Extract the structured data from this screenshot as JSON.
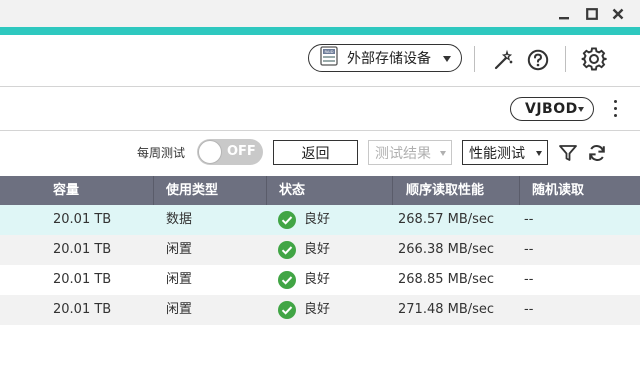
{
  "window": {
    "minimize_icon": "minimize-icon",
    "maximize_icon": "maximize-icon",
    "close_icon": "close-icon"
  },
  "colors": {
    "accent": "#2ec8bf",
    "header_bg": "#6d7080",
    "row_selected": "#dff6f6",
    "row_alt": "#f2f2f2",
    "status_ok": "#41a545",
    "toggle_off": "#c9c9c9"
  },
  "toolbar": {
    "external_storage_label": "外部存储设备",
    "external_storage_icon": "raid-drive-icon",
    "tool_icon": "wand-icon",
    "help_icon": "help-icon",
    "settings_icon": "gear-icon"
  },
  "device": {
    "selected": "VJBOD",
    "more_icon": "more-vertical-icon"
  },
  "controls": {
    "weekly_test_label": "每周测试",
    "toggle_state": "OFF",
    "back_label": "返回",
    "test_results_label": "测试结果",
    "performance_test_label": "性能测试",
    "filter_icon": "filter-icon",
    "refresh_icon": "refresh-icon"
  },
  "table": {
    "headers": [
      "容量",
      "使用类型",
      "状态",
      "顺序读取性能",
      "随机读取"
    ],
    "rows": [
      {
        "capacity": "20.01 TB",
        "usage": "数据",
        "status": "良好",
        "seq_read": "268.57 MB/sec",
        "random_read": "--",
        "selected": true
      },
      {
        "capacity": "20.01 TB",
        "usage": "闲置",
        "status": "良好",
        "seq_read": "266.38 MB/sec",
        "random_read": "--",
        "selected": false
      },
      {
        "capacity": "20.01 TB",
        "usage": "闲置",
        "status": "良好",
        "seq_read": "268.85 MB/sec",
        "random_read": "--",
        "selected": false
      },
      {
        "capacity": "20.01 TB",
        "usage": "闲置",
        "status": "良好",
        "seq_read": "271.48 MB/sec",
        "random_read": "--",
        "selected": false
      }
    ]
  }
}
